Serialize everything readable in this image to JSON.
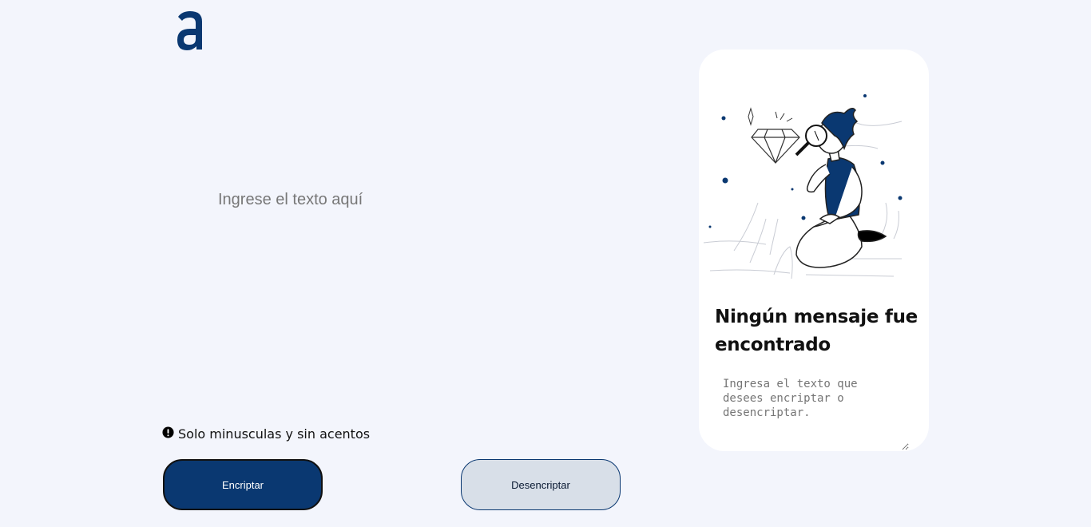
{
  "logo": {
    "icon": "alura-logo-icon",
    "color": "#0a3871"
  },
  "input": {
    "placeholder": "Ingrese el texto aquí",
    "value": ""
  },
  "hint": {
    "icon": "exclamation-circle-icon",
    "text": "Solo minusculas y sin acentos"
  },
  "buttons": {
    "encrypt_label": "Encriptar",
    "decrypt_label": "Desencriptar"
  },
  "output_panel": {
    "illustration": "searching-person-illustration",
    "title": "Ningún mensaje fue encontrado",
    "placeholder": "Ingresa el texto que desees encriptar o desencriptar."
  },
  "colors": {
    "background": "#f3f5fc",
    "accent": "#0a3871",
    "decrypt_button_bg": "#d8dfe8",
    "panel_bg": "#ffffff"
  }
}
